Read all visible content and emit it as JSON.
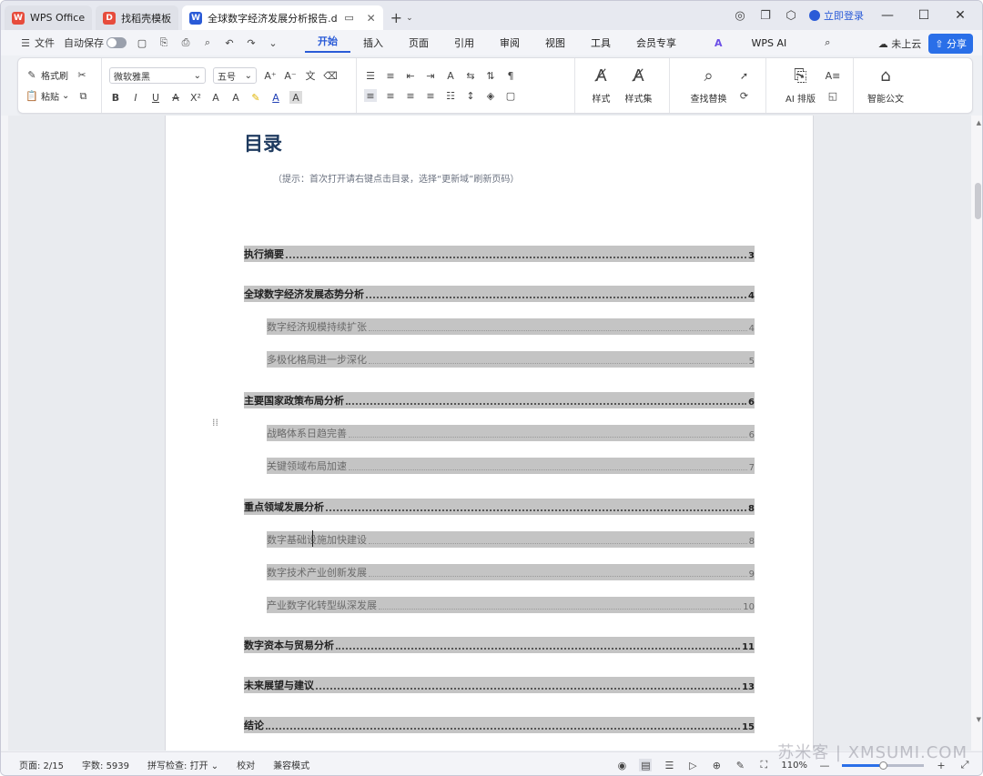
{
  "tabs": [
    {
      "label": "WPS Office",
      "icon": "wps-logo-icon",
      "color": "#e74c3c"
    },
    {
      "label": "找稻壳模板",
      "icon": "docer-logo-icon",
      "color": "#e74c3c"
    },
    {
      "label": "全球数字经济发展分析报告.d",
      "icon": "word-doc-icon",
      "color": "#2a5bd7"
    }
  ],
  "titlebar": {
    "login": "立即登录"
  },
  "menubar": {
    "file": "文件",
    "autosave": "自动保存",
    "items": [
      "开始",
      "插入",
      "页面",
      "引用",
      "审阅",
      "视图",
      "工具",
      "会员专享"
    ],
    "active": "开始",
    "wps_ai": "WPS AI",
    "cloud": "未上云",
    "share": "分享"
  },
  "ribbon": {
    "format_painter": "格式刷",
    "paste": "粘贴",
    "font": "微软雅黑",
    "size": "五号",
    "styles": "样式",
    "style_set": "样式集",
    "find_replace": "查找替换",
    "ai_layout": "AI 排版",
    "smart_doc": "智能公文"
  },
  "doc": {
    "toc_title": "目录",
    "hint": "（提示：首次打开请右键点击目录，选择“更新域”刷新页码）",
    "entries": [
      {
        "level": 1,
        "text": "执行摘要",
        "page": "3"
      },
      {
        "level": 1,
        "text": "全球数字经济发展态势分析",
        "page": "4"
      },
      {
        "level": 2,
        "text": "数字经济规模持续扩张",
        "page": "4"
      },
      {
        "level": 2,
        "text": "多极化格局进一步深化",
        "page": "5"
      },
      {
        "level": 1,
        "text": "主要国家政策布局分析",
        "page": "6"
      },
      {
        "level": 2,
        "text": "战略体系日趋完善",
        "page": "6"
      },
      {
        "level": 2,
        "text": "关键领域布局加速",
        "page": "7"
      },
      {
        "level": 1,
        "text": "重点领域发展分析",
        "page": "8"
      },
      {
        "level": 2,
        "text": "数字基础设施加快建设",
        "page": "8"
      },
      {
        "level": 2,
        "text": "数字技术产业创新发展",
        "page": "9"
      },
      {
        "level": 2,
        "text": "产业数字化转型纵深发展",
        "page": "10"
      },
      {
        "level": 1,
        "text": "数字资本与贸易分析",
        "page": "11"
      },
      {
        "level": 1,
        "text": "未来展望与建议",
        "page": "13"
      },
      {
        "level": 1,
        "text": "结论",
        "page": "15"
      }
    ]
  },
  "status": {
    "page": "页面: 2/15",
    "words": "字数: 5939",
    "spell": "拼写检查: 打开",
    "proof": "校对",
    "compat": "兼容模式",
    "zoom": "110%",
    "zoom_fraction": 0.5
  },
  "watermark": "苏米客 | XMSUMI.COM"
}
